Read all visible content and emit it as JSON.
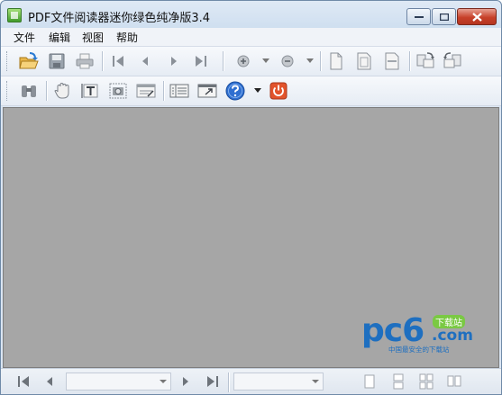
{
  "window": {
    "title": "PDF文件阅读器迷你绿色纯净版3.4",
    "controls": [
      "minimize",
      "maximize",
      "close"
    ]
  },
  "menu": {
    "items": [
      "文件",
      "编辑",
      "视图",
      "帮助"
    ]
  },
  "toolbar1": {
    "icons": [
      "open-folder-icon",
      "save-disk-icon",
      "print-icon",
      "first-page-icon",
      "prev-page-icon",
      "next-page-icon",
      "last-page-icon",
      "zoom-in-icon",
      "zoom-out-icon",
      "page-single-icon",
      "page-fit-icon",
      "page-width-icon",
      "rotate-clockwise-icon",
      "rotate-counterclockwise-icon"
    ]
  },
  "toolbar2": {
    "icons": [
      "binoculars-search-icon",
      "hand-pan-icon",
      "text-select-icon",
      "snapshot-camera-icon",
      "properties-icon",
      "bookmarks-panel-icon",
      "fullscreen-icon",
      "help-icon",
      "power-exit-icon"
    ]
  },
  "statusbar": {
    "page_combo_value": "",
    "zoom_combo_value": ""
  },
  "watermark": {
    "brand": "pc6",
    "domain": ".com",
    "badge": "下载站",
    "tagline": "中国最安全的下载站"
  },
  "colors": {
    "viewer_background": "#a6a6a6",
    "accent_blue": "#1e6fc0",
    "accent_green": "#7ac943",
    "close_red": "#c7412a"
  }
}
